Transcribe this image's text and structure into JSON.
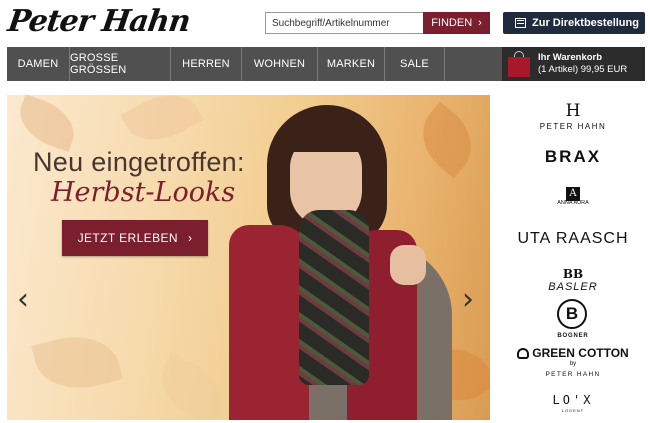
{
  "header": {
    "logo_text": "Peter Hahn",
    "search": {
      "placeholder": "Suchbegriff/Artikelnummer",
      "button_label": "FINDEN"
    },
    "direct_order_label": "Zur Direktbestellung"
  },
  "nav": {
    "items": [
      {
        "label": "DAMEN"
      },
      {
        "label": "GROSSE GRÖSSEN"
      },
      {
        "label": "HERREN"
      },
      {
        "label": "WOHNEN"
      },
      {
        "label": "MARKEN"
      },
      {
        "label": "SALE"
      }
    ],
    "cart": {
      "title": "Ihr Warenkorb",
      "summary": "(1 Artikel) 99,95 EUR"
    }
  },
  "hero": {
    "headline_line1": "Neu eingetroffen:",
    "headline_line2": "Herbst-Looks",
    "cta_label": "JETZT ERLEBEN",
    "prev_arrow": "‹",
    "next_arrow": "›"
  },
  "brands": {
    "peter_hahn_monogram": "H",
    "peter_hahn": "PETER HAHN",
    "brax": "BRAX",
    "anna_aura_monogram": "A",
    "anna_aura": "ANNA AURA",
    "uta_raasch": "UTA RAASCH",
    "basler_monogram": "BB",
    "basler": "BASLER",
    "bogner_monogram": "B",
    "bogner": "BOGNER",
    "green_cotton": "GREEN COTTON",
    "green_cotton_by": "by",
    "green_cotton_peter_hahn": "PETER HAHN",
    "lox": "LO'X",
    "lox_sub": "LODENT"
  },
  "colors": {
    "accent": "#7b1e2d",
    "nav_bg": "#505050",
    "cart_bg": "#2c2c2c",
    "direct_order_bg": "#1f2a3c"
  }
}
